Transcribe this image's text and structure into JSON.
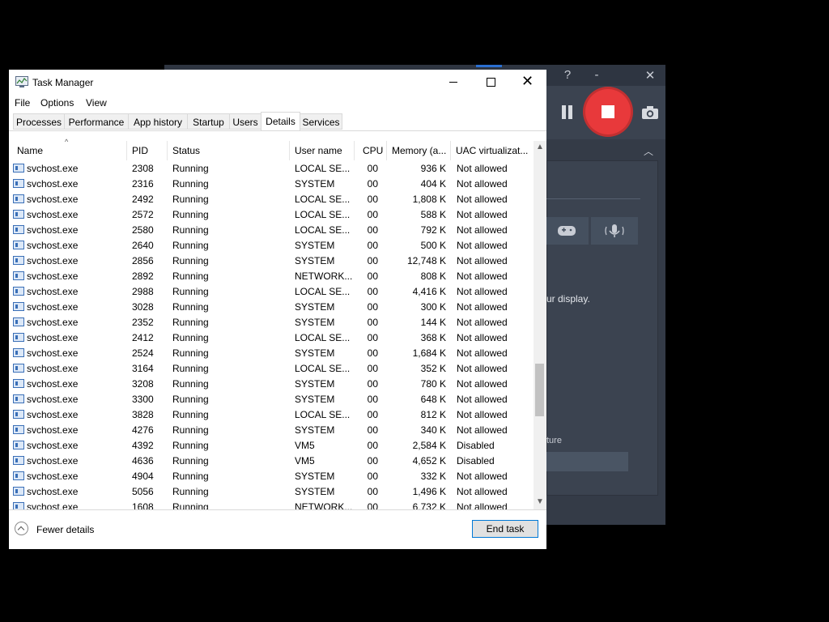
{
  "recorder": {
    "help_glyph": "?",
    "minimize_glyph": "-",
    "close_glyph": "✕",
    "collapse_glyph": "︿",
    "partial_display_text": "ur display.",
    "partial_capture_text": "ture",
    "accent_color": "#e8393b"
  },
  "window": {
    "title": "Task Manager",
    "close_glyph": "✕"
  },
  "menu": {
    "file": "File",
    "options": "Options",
    "view": "View"
  },
  "tabs": [
    {
      "label": "Processes",
      "active": false
    },
    {
      "label": "Performance",
      "active": false
    },
    {
      "label": "App history",
      "active": false
    },
    {
      "label": "Startup",
      "active": false
    },
    {
      "label": "Users",
      "active": false
    },
    {
      "label": "Details",
      "active": true
    },
    {
      "label": "Services",
      "active": false
    }
  ],
  "columns": {
    "name": "Name",
    "pid": "PID",
    "status": "Status",
    "user": "User name",
    "cpu": "CPU",
    "memory": "Memory (a...",
    "uac": "UAC virtualizat..."
  },
  "sort_glyph": "^",
  "rows": [
    {
      "name": "svchost.exe",
      "pid": "2308",
      "status": "Running",
      "user": "LOCAL SE...",
      "cpu": "00",
      "memory": "936 K",
      "uac": "Not allowed"
    },
    {
      "name": "svchost.exe",
      "pid": "2316",
      "status": "Running",
      "user": "SYSTEM",
      "cpu": "00",
      "memory": "404 K",
      "uac": "Not allowed"
    },
    {
      "name": "svchost.exe",
      "pid": "2492",
      "status": "Running",
      "user": "LOCAL SE...",
      "cpu": "00",
      "memory": "1,808 K",
      "uac": "Not allowed"
    },
    {
      "name": "svchost.exe",
      "pid": "2572",
      "status": "Running",
      "user": "LOCAL SE...",
      "cpu": "00",
      "memory": "588 K",
      "uac": "Not allowed"
    },
    {
      "name": "svchost.exe",
      "pid": "2580",
      "status": "Running",
      "user": "LOCAL SE...",
      "cpu": "00",
      "memory": "792 K",
      "uac": "Not allowed"
    },
    {
      "name": "svchost.exe",
      "pid": "2640",
      "status": "Running",
      "user": "SYSTEM",
      "cpu": "00",
      "memory": "500 K",
      "uac": "Not allowed"
    },
    {
      "name": "svchost.exe",
      "pid": "2856",
      "status": "Running",
      "user": "SYSTEM",
      "cpu": "00",
      "memory": "12,748 K",
      "uac": "Not allowed"
    },
    {
      "name": "svchost.exe",
      "pid": "2892",
      "status": "Running",
      "user": "NETWORK...",
      "cpu": "00",
      "memory": "808 K",
      "uac": "Not allowed"
    },
    {
      "name": "svchost.exe",
      "pid": "2988",
      "status": "Running",
      "user": "LOCAL SE...",
      "cpu": "00",
      "memory": "4,416 K",
      "uac": "Not allowed"
    },
    {
      "name": "svchost.exe",
      "pid": "3028",
      "status": "Running",
      "user": "SYSTEM",
      "cpu": "00",
      "memory": "300 K",
      "uac": "Not allowed"
    },
    {
      "name": "svchost.exe",
      "pid": "2352",
      "status": "Running",
      "user": "SYSTEM",
      "cpu": "00",
      "memory": "144 K",
      "uac": "Not allowed"
    },
    {
      "name": "svchost.exe",
      "pid": "2412",
      "status": "Running",
      "user": "LOCAL SE...",
      "cpu": "00",
      "memory": "368 K",
      "uac": "Not allowed"
    },
    {
      "name": "svchost.exe",
      "pid": "2524",
      "status": "Running",
      "user": "SYSTEM",
      "cpu": "00",
      "memory": "1,684 K",
      "uac": "Not allowed"
    },
    {
      "name": "svchost.exe",
      "pid": "3164",
      "status": "Running",
      "user": "LOCAL SE...",
      "cpu": "00",
      "memory": "352 K",
      "uac": "Not allowed"
    },
    {
      "name": "svchost.exe",
      "pid": "3208",
      "status": "Running",
      "user": "SYSTEM",
      "cpu": "00",
      "memory": "780 K",
      "uac": "Not allowed"
    },
    {
      "name": "svchost.exe",
      "pid": "3300",
      "status": "Running",
      "user": "SYSTEM",
      "cpu": "00",
      "memory": "648 K",
      "uac": "Not allowed"
    },
    {
      "name": "svchost.exe",
      "pid": "3828",
      "status": "Running",
      "user": "LOCAL SE...",
      "cpu": "00",
      "memory": "812 K",
      "uac": "Not allowed"
    },
    {
      "name": "svchost.exe",
      "pid": "4276",
      "status": "Running",
      "user": "SYSTEM",
      "cpu": "00",
      "memory": "340 K",
      "uac": "Not allowed"
    },
    {
      "name": "svchost.exe",
      "pid": "4392",
      "status": "Running",
      "user": "VM5",
      "cpu": "00",
      "memory": "2,584 K",
      "uac": "Disabled"
    },
    {
      "name": "svchost.exe",
      "pid": "4636",
      "status": "Running",
      "user": "VM5",
      "cpu": "00",
      "memory": "4,652 K",
      "uac": "Disabled"
    },
    {
      "name": "svchost.exe",
      "pid": "4904",
      "status": "Running",
      "user": "SYSTEM",
      "cpu": "00",
      "memory": "332 K",
      "uac": "Not allowed"
    },
    {
      "name": "svchost.exe",
      "pid": "5056",
      "status": "Running",
      "user": "SYSTEM",
      "cpu": "00",
      "memory": "1,496 K",
      "uac": "Not allowed"
    },
    {
      "name": "svchost.exe",
      "pid": "1608",
      "status": "Running",
      "user": "NETWORK...",
      "cpu": "00",
      "memory": "6,732 K",
      "uac": "Not allowed"
    }
  ],
  "scrollbar": {
    "up_glyph": "▲",
    "down_glyph": "▼",
    "position": 0.6
  },
  "footer": {
    "fewer_details": "Fewer details",
    "end_task": "End task"
  }
}
